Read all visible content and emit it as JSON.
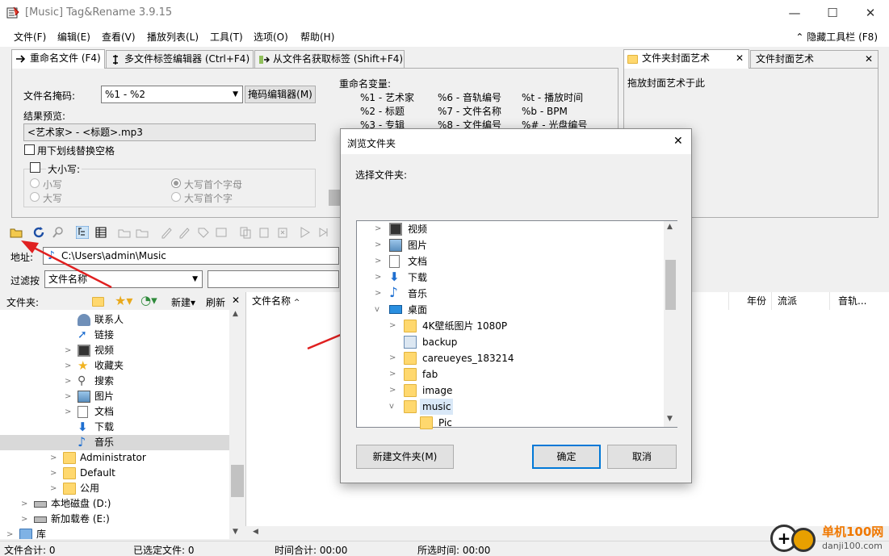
{
  "window": {
    "title": "[Music] Tag&Rename 3.9.15",
    "min": "—",
    "max": "☐",
    "close": "✕"
  },
  "menu": [
    "文件(F)",
    "编辑(E)",
    "查看(V)",
    "播放列表(L)",
    "工具(T)",
    "选项(O)",
    "帮助(H)"
  ],
  "hide_toolbar": "隐藏工具栏 (F8)",
  "tabs": [
    "重命名文件 (F4)",
    "多文件标签编辑器 (Ctrl+F4)",
    "从文件名获取标签 (Shift+F4)"
  ],
  "rename": {
    "mask_label": "文件名掩码:",
    "mask_value": "%1 - %2",
    "mask_editor": "掩码编辑器(M)",
    "preview_label": "结果预览:",
    "preview_value": "<艺术家> - <标题>.mp3",
    "underscore": "用下划线替换空格",
    "case_label": "大小写:",
    "lower": "小写",
    "upper": "大写",
    "cap_first": "大写首个字母",
    "cap_word": "大写首个字"
  },
  "vars": {
    "title": "重命名变量:",
    "items": [
      "%1 - 艺术家",
      "%6 - 音轨编号",
      "%t - 播放时间",
      "%2 - 标题",
      "%7 - 文件名称",
      "%b - BPM",
      "%3 - 专辑",
      "%8 - 文件编号",
      "%# - 光盘编号"
    ]
  },
  "right_tabs": [
    "文件夹封面艺术",
    "文件封面艺术"
  ],
  "cover_hint": "拖放封面艺术于此",
  "address_label": "地址:",
  "address_value": "C:\\Users\\admin\\Music",
  "filter_label": "过滤按",
  "filter_value": "文件名称",
  "folder_header": {
    "label": "文件夹:",
    "new": "新建",
    "refresh": "刷新"
  },
  "tree": [
    "联系人",
    "链接",
    "视频",
    "收藏夹",
    "搜索",
    "图片",
    "文档",
    "下载",
    "音乐",
    "Administrator",
    "Default",
    "公用",
    "本地磁盘 (D:)",
    "新加载卷 (E:)",
    "库"
  ],
  "columns": {
    "filename": "文件名称",
    "year": "年份",
    "genre": "流派",
    "track": "音轨..."
  },
  "status": {
    "total_files": "文件合计: 0",
    "selected_files": "已选定文件: 0",
    "total_time": "时间合计: 00:00",
    "selected_time": "所选时间: 00:00"
  },
  "dialog": {
    "title": "浏览文件夹",
    "prompt": "选择文件夹:",
    "items": [
      "视频",
      "图片",
      "文档",
      "下载",
      "音乐",
      "桌面",
      "4K壁纸图片 1080P",
      "backup",
      "careueyes_183214",
      "fab",
      "image",
      "music",
      "Pic"
    ],
    "new_folder": "新建文件夹(M)",
    "ok": "确定",
    "cancel": "取消"
  },
  "watermark": {
    "brand": "单机100网",
    "url": "danji100.com"
  }
}
